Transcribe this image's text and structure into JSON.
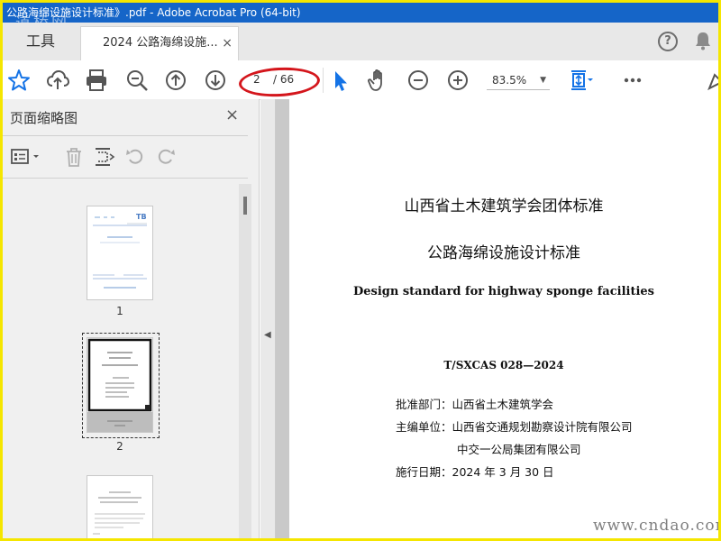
{
  "window": {
    "title": "公路海绵设施设计标准》.pdf - Adobe Acrobat Pro (64-bit)"
  },
  "watermarks": {
    "top": "道桥网",
    "bottom": "www.cndao.com"
  },
  "tabs": {
    "tools": "工具",
    "document": "2024 公路海绵设施...",
    "close": "×"
  },
  "toolbar": {
    "current_page": "2",
    "total_pages": "/ 66",
    "zoom": "83.5%"
  },
  "panel": {
    "title": "页面缩略图",
    "close": "×",
    "thumbnails": [
      {
        "label": "1"
      },
      {
        "label": "2"
      },
      {
        "label": ""
      }
    ]
  },
  "document": {
    "title_cn_1": "山西省土木建筑学会团体标准",
    "title_cn_2": "公路海绵设施设计标准",
    "title_en": "Design standard for highway sponge facilities",
    "code": "T/SXCAS 028—2024",
    "approval_label": "批准部门：",
    "approval_value": "山西省土木建筑学会",
    "editor_label": "主编单位：",
    "editor_value_1": "山西省交通规划勘察设计院有限公司",
    "editor_value_2": "中交一公局集团有限公司",
    "date_label": "施行日期：",
    "date_value": "2024 年 3 月 30 日"
  },
  "colors": {
    "titlebar": "#1565c8",
    "accent": "#1473e6",
    "highlight_oval": "#d4161c",
    "frame": "#f5e600"
  }
}
